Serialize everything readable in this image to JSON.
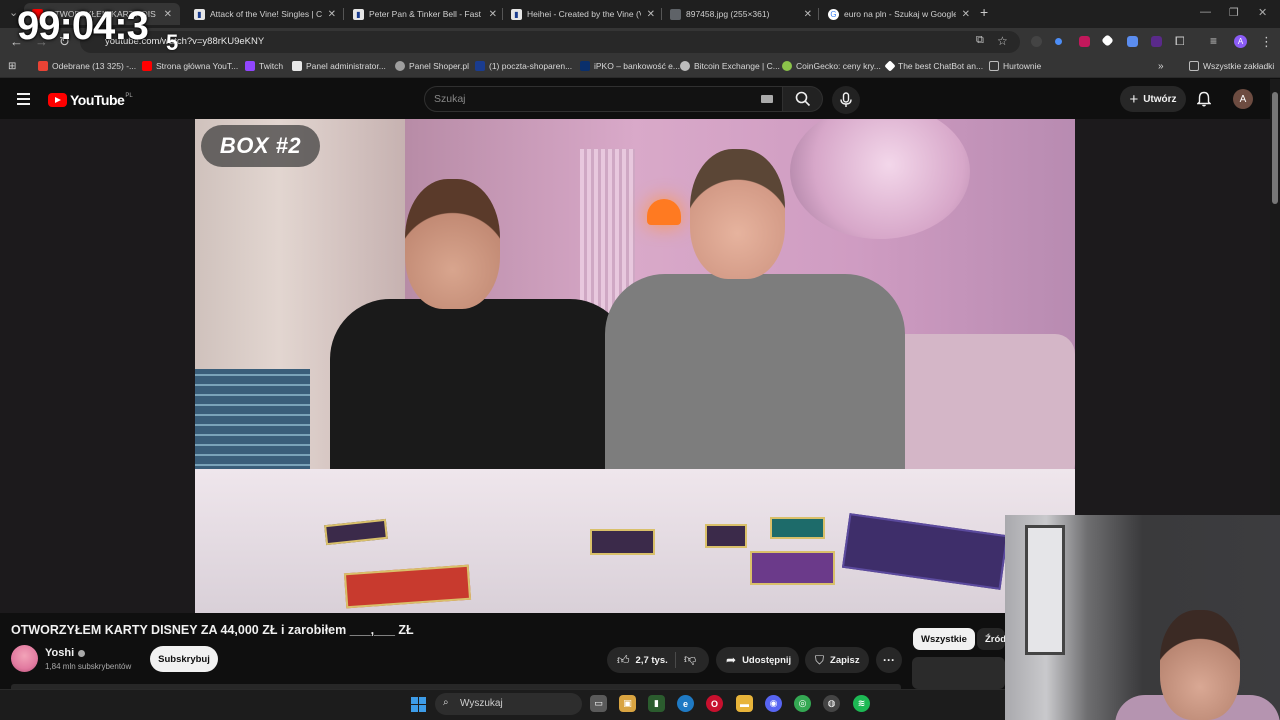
{
  "overlay": {
    "stopwatch": "99:04:3",
    "stopwatch_tail": "5"
  },
  "browser": {
    "tabs": [
      {
        "label": "OTWORZYŁEM KARTY DIS",
        "icon": "youtube-icon",
        "active": true
      },
      {
        "label": "Attack of the Vine! Singles | Ca",
        "icon": "document-icon",
        "active": false
      },
      {
        "label": "Peter Pan & Tinker Bell - Fast F",
        "icon": "document-icon",
        "active": false
      },
      {
        "label": "Heihei - Created by the Vine (V",
        "icon": "document-icon",
        "active": false
      },
      {
        "label": "897458.jpg (255×361)",
        "icon": "globe-icon",
        "active": false
      },
      {
        "label": "euro na pln - Szukaj w Google",
        "icon": "google-icon",
        "active": false
      }
    ],
    "url": "youtube.com/watch?v=y88rKU9eKNY",
    "bookmarks": [
      {
        "label": "Odebrane (13 325) -...",
        "color": "#ea4335"
      },
      {
        "label": "Strona główna YouT...",
        "color": "#ff0000"
      },
      {
        "label": "Twitch",
        "color": "#9146ff"
      },
      {
        "label": "Panel administrator...",
        "color": "#e8e8e8"
      },
      {
        "label": "Panel Shoper.pl",
        "color": "#9e9e9e"
      },
      {
        "label": "(1) poczta-shoparen...",
        "color": "#1a3c8f"
      },
      {
        "label": "iPKO – bankowość e...",
        "color": "#0a2f6b"
      },
      {
        "label": "Bitcoin Exchange | C...",
        "color": "#bdbdbd"
      },
      {
        "label": "CoinGecko: ceny kry...",
        "color": "#8bc34a"
      },
      {
        "label": "The best ChatBot an...",
        "color": "#ffffff"
      },
      {
        "label": "Hurtownie",
        "color": "#bdbdbd"
      }
    ],
    "all_bookmarks": "Wszystkie zakładki"
  },
  "youtube": {
    "logo_text": "YouTube",
    "country_code": "PL",
    "search_placeholder": "Szukaj",
    "create_label": "Utwórz",
    "avatar_letter": "A",
    "video_badge": "BOX #2",
    "video_title": "OTWORZYŁEM KARTY DISNEY ZA 44,000 ZŁ i zarobiłem ___,___ ZŁ",
    "channel_name": "Yoshi",
    "channel_subs": "1,84 mln subskrybentów",
    "subscribe_label": "Subskrybuj",
    "like_count": "2,7 tys.",
    "share_label": "Udostępnij",
    "save_label": "Zapisz",
    "filters": [
      "Wszystkie",
      "Źródł"
    ]
  },
  "taskbar": {
    "search_placeholder": "Wyszukaj"
  },
  "colors": {
    "accent_red": "#ff0000",
    "background": "#0f0f0f",
    "chip": "#272727"
  }
}
